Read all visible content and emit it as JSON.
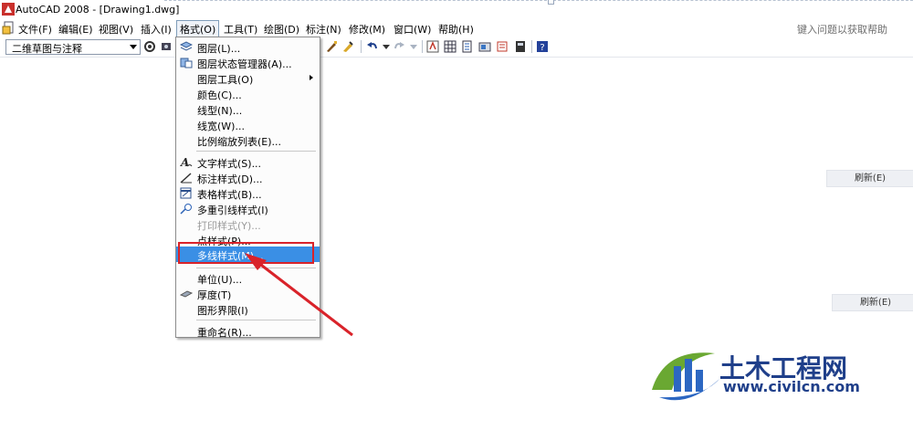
{
  "window": {
    "title": "AutoCAD 2008 - [Drawing1.dwg]"
  },
  "menubar": {
    "items": [
      "文件(F)",
      "编辑(E)",
      "视图(V)",
      "插入(I)",
      "格式(O)",
      "工具(T)",
      "绘图(D)",
      "标注(N)",
      "修改(M)",
      "窗口(W)",
      "帮助(H)"
    ],
    "active": "格式(O)",
    "help_placeholder": "键入问题以获取帮助"
  },
  "toolbar": {
    "workspace": "二维草图与注释"
  },
  "format_menu": {
    "items": [
      {
        "label": "图层(L)...",
        "icon": "layers-icon"
      },
      {
        "label": "图层状态管理器(A)...",
        "icon": "layer-state-icon"
      },
      {
        "label": "图层工具(O)",
        "submenu": true
      },
      {
        "label": "颜色(C)..."
      },
      {
        "label": "线型(N)..."
      },
      {
        "label": "线宽(W)..."
      },
      {
        "label": "比例缩放列表(E)..."
      },
      {
        "label": "文字样式(S)...",
        "icon": "text-style-icon"
      },
      {
        "label": "标注样式(D)...",
        "icon": "dim-style-icon"
      },
      {
        "label": "表格样式(B)...",
        "icon": "table-style-icon"
      },
      {
        "label": "多重引线样式(I)",
        "icon": "mleader-style-icon"
      },
      {
        "label": "打印样式(Y)...",
        "disabled": true
      },
      {
        "label": "点样式(P)..."
      },
      {
        "label": "多线样式(M)...",
        "highlighted": true
      },
      {
        "label": "单位(U)..."
      },
      {
        "label": "厚度(T)",
        "icon": "thickness-icon"
      },
      {
        "label": "图形界限(I)"
      },
      {
        "label": "重命名(R)..."
      }
    ]
  },
  "side_buttons": {
    "refresh_label": "刷新(E)"
  },
  "watermark": {
    "cn": "土木工程网",
    "url": "www.civilcn.com"
  },
  "colors": {
    "highlight": "#3a8fe5",
    "annotation_red": "#d9232a",
    "logo_blue": "#1f3f8a"
  }
}
